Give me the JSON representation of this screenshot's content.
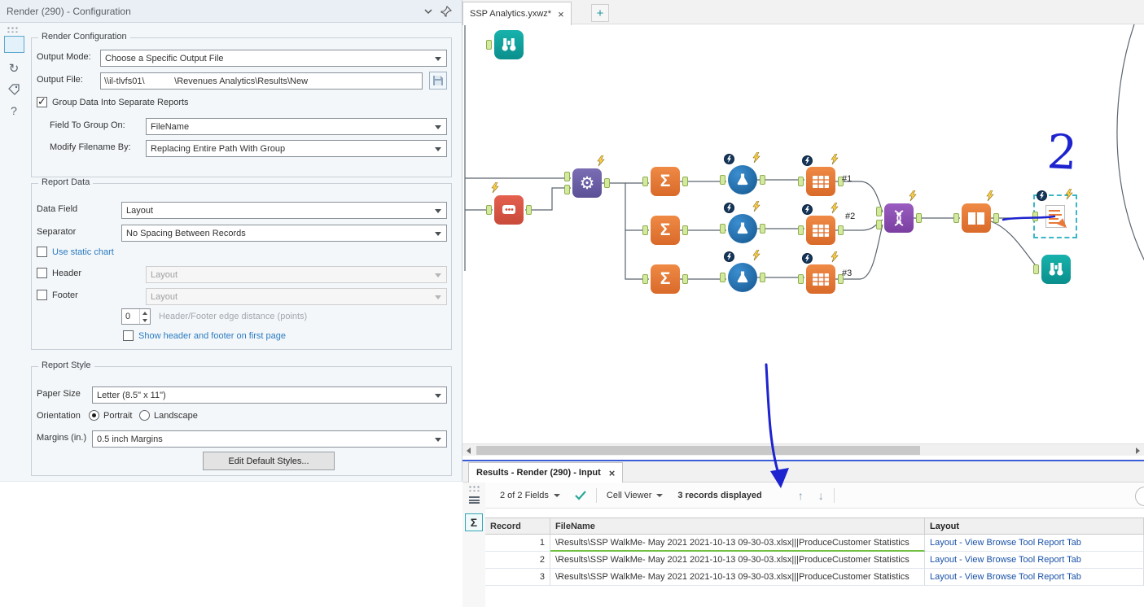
{
  "config_panel": {
    "title": "Render (290) - Configuration",
    "render_configuration": {
      "title": "Render Configuration",
      "output_mode_label": "Output Mode:",
      "output_mode_value": "Choose a Specific Output File",
      "output_file_label": "Output File:",
      "output_file_value": "\\\\il-tlvfs01\\            \\Revenues Analytics\\Results\\New",
      "group_reports_label": "Group Data Into Separate Reports",
      "field_group_label": "Field To Group On:",
      "field_group_value": "FileName",
      "modify_label": "Modify Filename By:",
      "modify_value": "Replacing Entire Path With Group"
    },
    "report_data": {
      "title": "Report Data",
      "data_field_label": "Data Field",
      "data_field_value": "Layout",
      "separator_label": "Separator",
      "separator_value": "No Spacing Between Records",
      "static_chart_label": "Use static chart",
      "header_label": "Header",
      "header_value": "Layout",
      "footer_label": "Footer",
      "footer_value": "Layout",
      "edge_value": "0",
      "edge_label": "Header/Footer edge distance (points)",
      "show_hf_label": "Show header and footer on first page"
    },
    "report_style": {
      "title": "Report Style",
      "paper_label": "Paper Size",
      "paper_value": "Letter (8.5\" x 11\")",
      "orientation_label": "Orientation",
      "portrait_label": "Portrait",
      "landscape_label": "Landscape",
      "margins_label": "Margins (in.)",
      "margins_value": "0.5 inch Margins",
      "edit_styles_label": "Edit Default Styles..."
    }
  },
  "canvas": {
    "tab_title": "SSP Analytics.yxwz*",
    "wire_labels": [
      "#1",
      "#2",
      "#3"
    ],
    "annotation": "2"
  },
  "results_panel": {
    "tab_title": "Results - Render (290) - Input",
    "fields_button": "2 of 2 Fields",
    "cell_viewer_button": "Cell Viewer",
    "records_text": "3 records displayed",
    "table": {
      "headers": [
        "Record",
        "FileName",
        "Layout"
      ],
      "rows": [
        {
          "record": "1",
          "filename": "\\Results\\SSP WalkMe- May 2021 2021-10-13 09-30-03.xlsx|||ProduceCustomer Statistics",
          "layout": "Layout - View Browse Tool Report Tab"
        },
        {
          "record": "2",
          "filename": "\\Results\\SSP WalkMe- May 2021 2021-10-13 09-30-03.xlsx|||ProduceCustomer Statistics",
          "layout": "Layout - View Browse Tool Report Tab"
        },
        {
          "record": "3",
          "filename": "\\Results\\SSP WalkMe- May 2021 2021-10-13 09-30-03.xlsx|||ProduceCustomer Statistics",
          "layout": "Layout - View Browse Tool Report Tab"
        }
      ]
    }
  }
}
